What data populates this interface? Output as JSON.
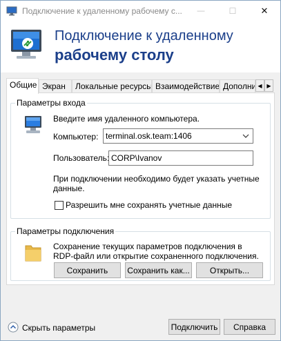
{
  "window": {
    "title": "Подключение к удаленному рабочему с...",
    "minimize_glyph": "—",
    "maximize_glyph": "☐",
    "close_glyph": "✕"
  },
  "banner": {
    "line1": "Подключение к удаленному",
    "line2": "рабочему столу"
  },
  "tabs": [
    {
      "label": "Общие",
      "active": true
    },
    {
      "label": "Экран",
      "active": false
    },
    {
      "label": "Локальные ресурсы",
      "active": false
    },
    {
      "label": "Взаимодействие",
      "active": false
    },
    {
      "label": "Дополни",
      "active": false
    }
  ],
  "tab_scroll": {
    "left": "◀",
    "right": "▶"
  },
  "login_group": {
    "title": "Параметры входа",
    "instruction": "Введите имя удаленного компьютера.",
    "computer_label": "Компьютер:",
    "computer_value": "terminal.osk.team:1406",
    "user_label": "Пользователь:",
    "user_value": "CORP\\Ivanov",
    "note_line1": "При подключении необходимо будет указать учетные",
    "note_line2": "данные.",
    "save_credentials_label": "Разрешить мне сохранять учетные данные",
    "save_credentials_checked": false
  },
  "connection_group": {
    "title": "Параметры подключения",
    "description_line1": "Сохранение текущих параметров подключения в",
    "description_line2": "RDP-файл или открытие сохраненного подключения.",
    "save_button": "Сохранить",
    "save_as_button": "Сохранить как...",
    "open_button": "Открыть..."
  },
  "footer": {
    "hide_options": "Скрыть параметры",
    "connect_button": "Подключить",
    "help_button": "Справка"
  },
  "colors": {
    "banner_text": "#1b3f8a",
    "window_bg": "#f0f0f0",
    "panel_bg": "#ffffff",
    "button_bg": "#e1e1e1"
  }
}
